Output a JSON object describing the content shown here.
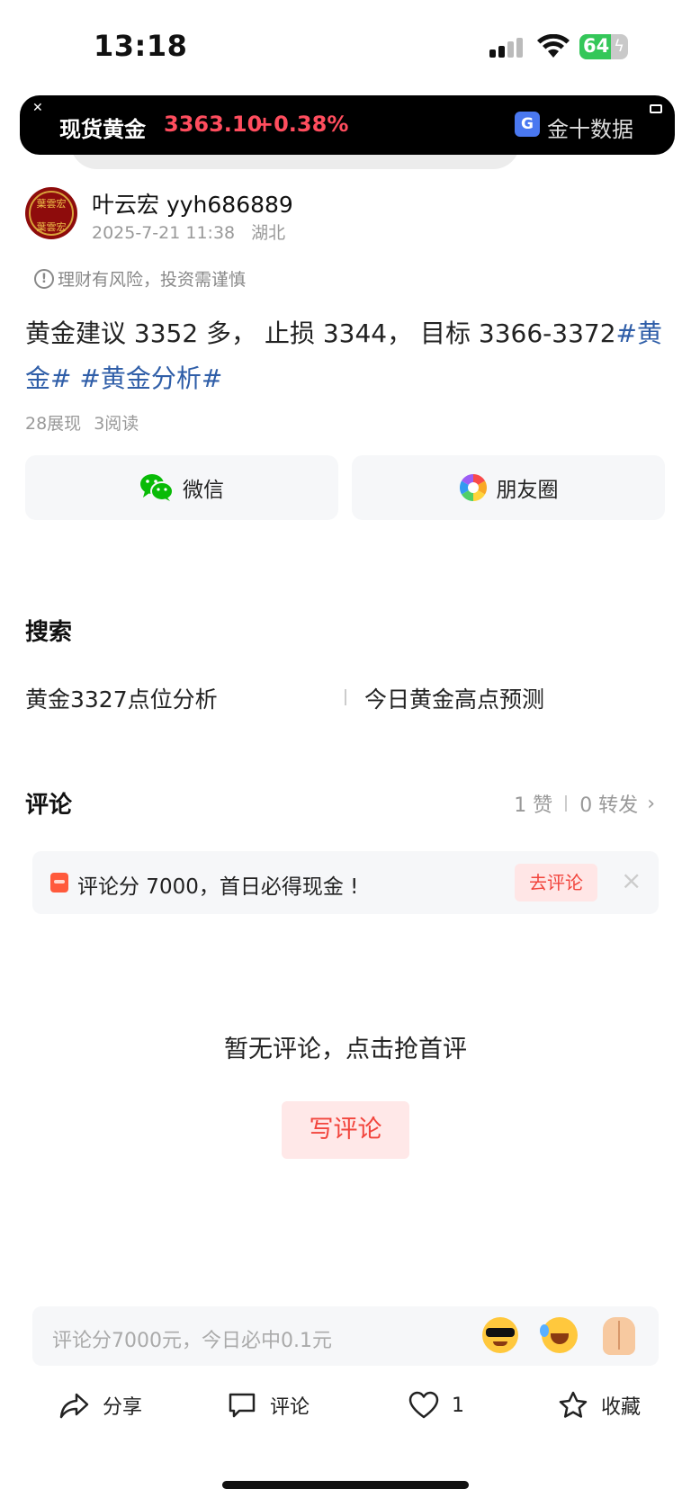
{
  "status": {
    "time": "13:18",
    "battery": "64"
  },
  "ticker": {
    "name": "现货黄金",
    "price": "3363.10",
    "change": "+0.38%",
    "brand": "金十数据"
  },
  "post": {
    "author": "叶云宏 yyh686889",
    "date": "2025-7-21 11:38",
    "location": "湖北",
    "avatar_text_top": "葉雲宏",
    "avatar_text_bottom": "葉雲宏",
    "risk_notice": "理财有风险，投资需谨慎",
    "content_text": "黄金建议 3352 多， 止损 3344， 目标 3366-3372",
    "tag1": "#黄金#",
    "tag2": "#黄金分析#",
    "views": "28展现",
    "reads": "3阅读"
  },
  "share": {
    "wechat": "微信",
    "moments": "朋友圈"
  },
  "search": {
    "title": "搜索",
    "items": [
      "黄金3327点位分析",
      "今日黄金高点预测"
    ]
  },
  "comments": {
    "title": "评论",
    "likes": "1 赞",
    "forwards": "0 转发",
    "promo_text": "评论分 7000，首日必得现金 !",
    "promo_button": "去评论",
    "empty_text": "暂无评论，点击抢首评",
    "write_button": "写评论"
  },
  "input": {
    "placeholder": "评论分7000元，今日必中0.1元"
  },
  "bottom_bar": {
    "share": "分享",
    "comment": "评论",
    "like_count": "1",
    "favorite": "收藏"
  },
  "colors": {
    "accent_red": "#f2453d",
    "tag_blue": "#2f5ea8",
    "ticker_red": "#ff4d5e",
    "wechat_green": "#09bb07"
  }
}
